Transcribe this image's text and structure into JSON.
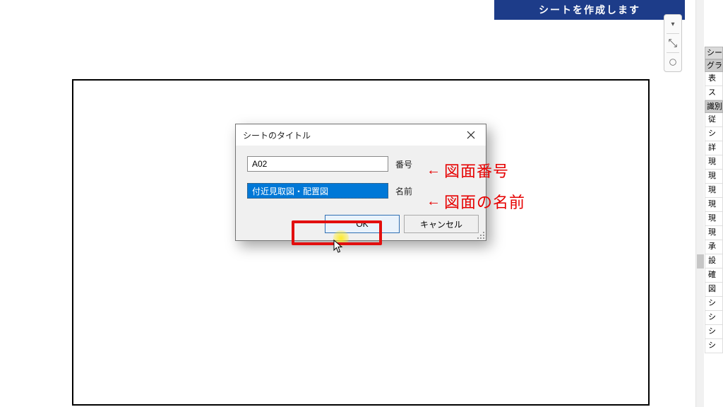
{
  "banner": {
    "text": "シートを作成します"
  },
  "dialog": {
    "title": "シートのタイトル",
    "fields": {
      "number": {
        "value": "A02",
        "label": "番号"
      },
      "name": {
        "value": "付近見取図・配置図",
        "label": "名前"
      }
    },
    "buttons": {
      "ok": "OK",
      "cancel": "キャンセル"
    }
  },
  "annotations": {
    "number": {
      "arrow": "←",
      "text": "図面番号"
    },
    "name": {
      "arrow": "←",
      "text": "図面の名前"
    }
  },
  "properties": {
    "header1": "シー",
    "group_graphics": "グラ",
    "items": [
      "表",
      "ス",
      "識別",
      "従",
      "シ",
      "詳",
      "現",
      "現",
      "現",
      "現",
      "現",
      "現",
      "承",
      "設",
      "確",
      "図",
      "シ",
      "シ",
      "シ",
      "シ"
    ]
  }
}
